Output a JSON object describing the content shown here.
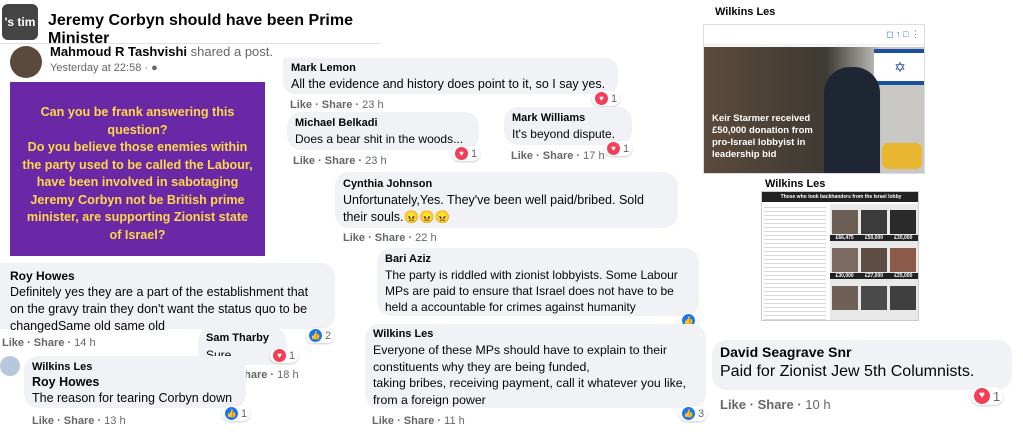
{
  "post": {
    "group_tag": "'s tim",
    "group_title": "Jeremy Corbyn should have been Prime Minister",
    "author": "Mahmoud R Tashvishi",
    "action": "shared a post.",
    "time": "Yesterday at 22:58 ·",
    "image_text": "Can you be frank answering this question?\nDo you believe those enemies within the party used to be called the Labour, have been involved in sabotaging Jeremy Corbyn not be British prime minister, are supporting Zionist state of Israel?"
  },
  "labels": {
    "like": "Like",
    "share": "Share",
    "sep": " · "
  },
  "comments": [
    {
      "id": "mark-lemon",
      "name": "Mark Lemon",
      "text": "All the evidence and history does point to it, so I say yes.",
      "time": "23 h",
      "react_count": "1"
    },
    {
      "id": "mark-williams",
      "name": "Mark Williams",
      "text": "It's beyond dispute.",
      "time": "17 h",
      "react_count": "1"
    },
    {
      "id": "michael-belkadi",
      "name": "Michael Belkadi",
      "text": "Does a bear shit in the woods...",
      "time": "23 h",
      "react_count": "1"
    },
    {
      "id": "cynthia-johnson",
      "name": "Cynthia Johnson",
      "text": "Unfortunately,Yes. They've been well paid/bribed. Sold their souls.😠😠😠",
      "time": "22 h"
    },
    {
      "id": "bari-aziz",
      "name": "Bari Aziz",
      "text": "The party is riddled with zionist lobbyists. Some Labour MPs are paid to ensure that Israel does not have to be held a accountable for crimes against humanity"
    },
    {
      "id": "roy-howes",
      "name": "Roy Howes",
      "text": "Definitely yes they are a part of the establishment that on the gravy train they don't want the status quo to be changedSame old same old",
      "time": "14 h",
      "react_count": "2"
    },
    {
      "id": "sam-tharby",
      "name": "Sam Tharby",
      "text": "Sure",
      "time": "18 h",
      "react_count": "1"
    },
    {
      "id": "wilkins-les-reply",
      "name": "Wilkins Les",
      "mention": "Roy Howes",
      "text": "The reason for tearing Corbyn down",
      "time": "13 h",
      "react_count": "1"
    },
    {
      "id": "wilkins-les-main",
      "name": "Wilkins Les",
      "text": "Everyone of these MPs should have to explain to their constituents why they are being funded,\ntaking bribes, receiving payment, call it whatever you like, from a foreign power",
      "time": "11 h",
      "react_count": "3"
    },
    {
      "id": "david-seagrave",
      "name": "David Seagrave Snr",
      "text": "Paid for Zionist Jew 5th Columnists.",
      "time": "10 h",
      "react_count": "1"
    }
  ],
  "right": {
    "top_name": "Wilkins Les",
    "banner_text": "Keir Starmer received £50,000 donation from pro-Israel lobbyist in leadership bid",
    "mid_name": "Wilkins Les",
    "table_title": "Those who took backhanders from the Israel lobby",
    "amounts_row1": [
      "£66,475",
      "£50,000",
      "£30,000"
    ],
    "amounts_row2": [
      "£30,000",
      "£27,000",
      "£25,000"
    ],
    "colors": {
      "like_blue": "#1877f2",
      "heart_red": "#f33e58",
      "purple": "#6a27a6",
      "yellow_text": "#ffd84a",
      "gold_text": "#f5a623"
    }
  }
}
